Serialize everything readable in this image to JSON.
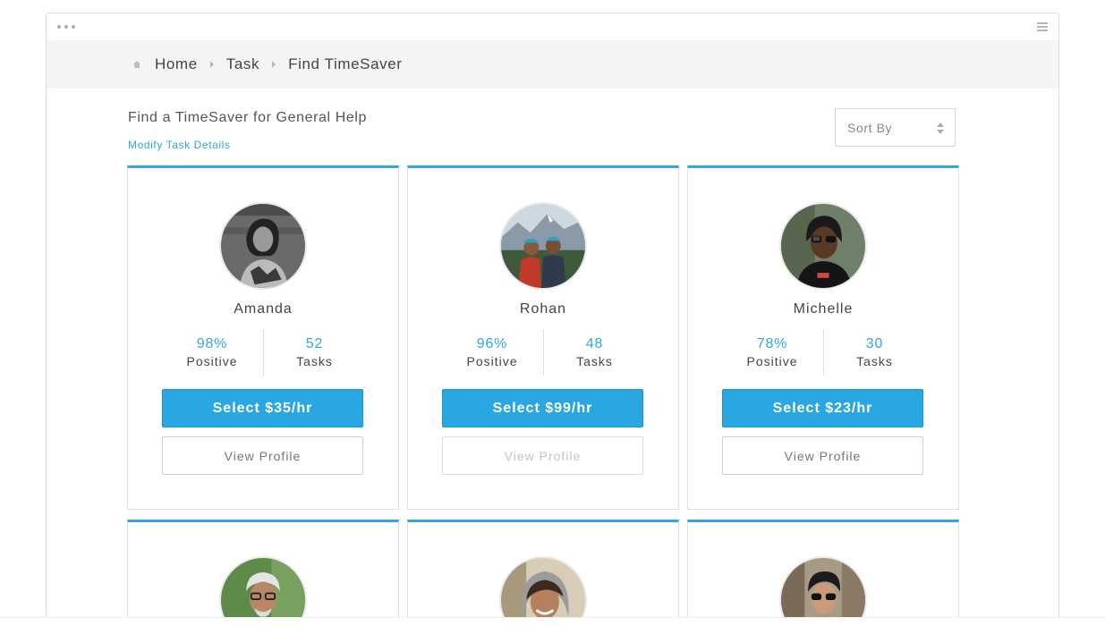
{
  "breadcrumb": {
    "items": [
      "Home",
      "Task",
      "Find TimeSaver"
    ]
  },
  "page": {
    "title": "Find a TimeSaver for General Help",
    "modify_link": "Modify Task Details",
    "sort_label": "Sort By"
  },
  "cards": [
    {
      "name": "Amanda",
      "positive": "98%",
      "positive_label": "Positive",
      "tasks": "52",
      "tasks_label": "Tasks",
      "select_label": "Select $35/hr",
      "profile_label": "View Profile",
      "profile_disabled": false
    },
    {
      "name": "Rohan",
      "positive": "96%",
      "positive_label": "Positive",
      "tasks": "48",
      "tasks_label": "Tasks",
      "select_label": "Select $99/hr",
      "profile_label": "View Profile",
      "profile_disabled": true
    },
    {
      "name": "Michelle",
      "positive": "78%",
      "positive_label": "Positive",
      "tasks": "30",
      "tasks_label": "Tasks",
      "select_label": "Select $23/hr",
      "profile_label": "View Profile",
      "profile_disabled": false
    }
  ],
  "colors": {
    "accent": "#2ea8e0",
    "button": "#2aa6e1",
    "breadcrumb_bg": "#f4f4f4"
  }
}
